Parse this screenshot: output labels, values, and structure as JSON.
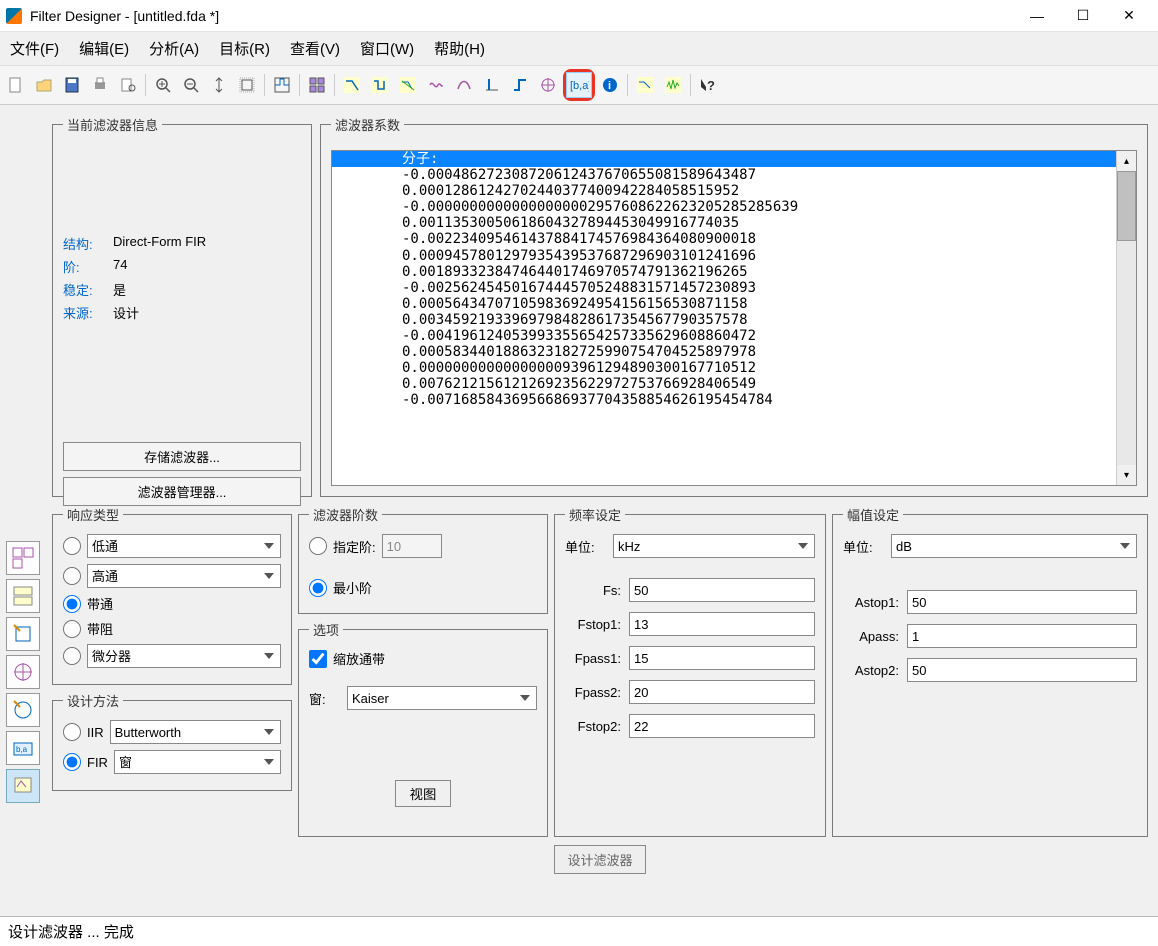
{
  "window": {
    "title": "Filter Designer -  [untitled.fda *]",
    "minimize": "—",
    "maximize": "☐",
    "close": "✕"
  },
  "menu": {
    "file": "文件(F)",
    "edit": "编辑(E)",
    "analyze": "分析(A)",
    "target": "目标(R)",
    "view": "查看(V)",
    "window": "窗口(W)",
    "help": "帮助(H)"
  },
  "info": {
    "legend": "当前滤波器信息",
    "structure_label": "结构:",
    "structure": "Direct-Form FIR",
    "order_label": "阶:",
    "order": "74",
    "stable_label": "稳定:",
    "stable": "是",
    "source_label": "来源:",
    "source": "设计",
    "store_btn": "存储滤波器...",
    "manager_btn": "滤波器管理器..."
  },
  "coeff": {
    "legend": "滤波器系数",
    "header": "分子:",
    "lines": [
      "-0.00048627230872061243767065508158964­3487",
      " 0.00012861242702440377400942284058515952",
      "-0.000000000000000000029576086226232052852­85639",
      " 0.00113530050618604327894453049916774035",
      "-0.0022340954614378841745769843640809­00018",
      " 0.0009457801297935439537687296903101241696",
      " 0.0018933238474644017469705747913621­96265",
      "-0.0025624545016744457052488315714572­30893",
      " 0.0005643470710598369249541561565308­71158",
      " 0.0034592193396979848286173545677903­57578",
      "-0.0041961240539933556542573356296088­60472",
      " 0.0005834401886323182725990754704525­897978",
      " 0.0000000000000000093961294890300167710512",
      " 0.0076212156121269235622972753766928­406549",
      "-0.0071685843695668693770435885462619­5454784"
    ]
  },
  "response": {
    "legend": "响应类型",
    "lowpass": "低通",
    "highpass": "高通",
    "bandpass": "带通",
    "bandstop": "带阻",
    "diff": "微分器"
  },
  "design_method": {
    "legend": "设计方法",
    "iir": "IIR",
    "iir_select": "Butterworth",
    "fir": "FIR",
    "fir_select": "窗"
  },
  "order": {
    "legend": "滤波器阶数",
    "specify": "指定阶:",
    "specify_val": "10",
    "min": "最小阶"
  },
  "options": {
    "legend": "选项",
    "scale": "缩放通带",
    "window": "窗:",
    "window_val": "Kaiser",
    "view_btn": "视图"
  },
  "freq": {
    "legend": "频率设定",
    "unit": "单位:",
    "unit_val": "kHz",
    "fs": "Fs:",
    "fs_val": "50",
    "fst1": "Fstop1:",
    "fst1_val": "13",
    "fp1": "Fpass1:",
    "fp1_val": "15",
    "fp2": "Fpass2:",
    "fp2_val": "20",
    "fst2": "Fstop2:",
    "fst2_val": "22"
  },
  "mag": {
    "legend": "幅值设定",
    "unit": "单位:",
    "unit_val": "dB",
    "ast1": "Astop1:",
    "ast1_val": "50",
    "ap": "Apass:",
    "ap_val": "1",
    "ast2": "Astop2:",
    "ast2_val": "50"
  },
  "design_btn": "设计滤波器",
  "status": "设计滤波器 ... 完成"
}
